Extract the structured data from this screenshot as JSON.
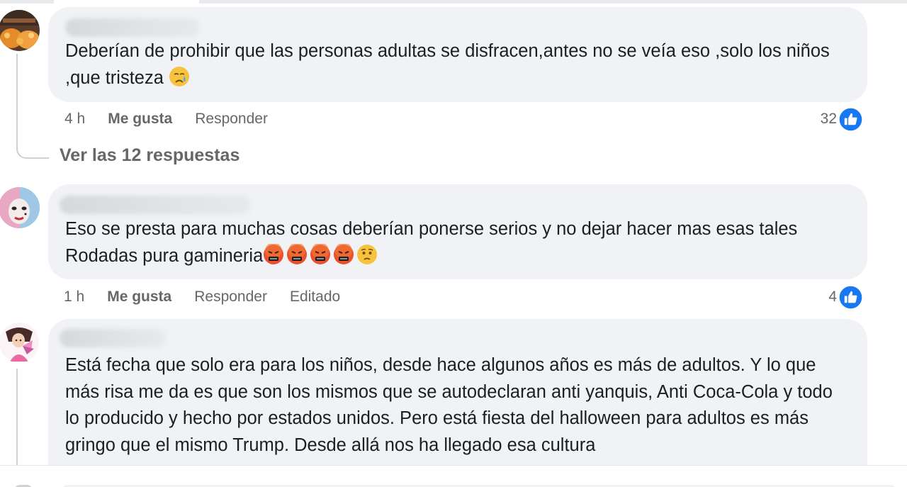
{
  "colors": {
    "bubble": "#f0f2f5",
    "text": "#1c1e21",
    "meta": "#65676b",
    "like_blue": "#1877f2"
  },
  "comments": [
    {
      "text": "Deberían de prohibir que las personas adultas se disfracen,antes no se veía eso ,solo los niños ,que tristeza",
      "emojis": [
        "crying-face"
      ],
      "time": "4 h",
      "like_label": "Me gusta",
      "reply_label": "Responder",
      "reaction_count": "32",
      "reaction_icon": "thumbs-up-icon"
    },
    {
      "text": "Eso se presta para muchas cosas deberían ponerse serios y no dejar hacer mas esas tales Rodadas pura gamineria",
      "emojis": [
        "swearing-face",
        "swearing-face",
        "swearing-face",
        "swearing-face",
        "worried-face"
      ],
      "time": "1 h",
      "like_label": "Me gusta",
      "reply_label": "Responder",
      "edited_label": "Editado",
      "reaction_count": "4",
      "reaction_icon": "thumbs-up-icon"
    },
    {
      "text": "Está fecha que solo era para los niños, desde hace algunos años es más de adultos. Y lo que más risa me da es que son los mismos que se autodeclaran anti yanquis, Anti Coca-Cola y todo lo producido y hecho por estados unidos. Pero está fiesta del halloween para adultos es más gringo que el mismo Trump. Desde allá nos ha llegado esa cultura"
    }
  ],
  "view_replies_label": "Ver las 12 respuestas"
}
